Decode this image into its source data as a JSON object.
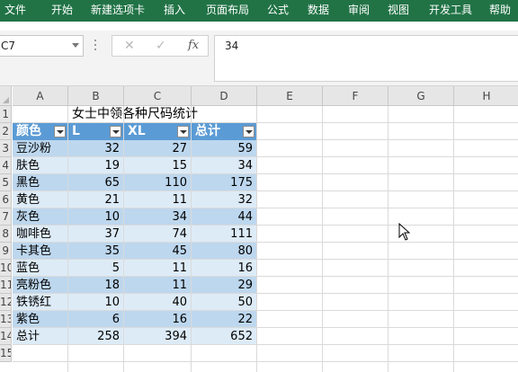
{
  "ribbon": {
    "tabs": [
      "文件",
      "开始",
      "新建选项卡",
      "插入",
      "页面布局",
      "公式",
      "数据",
      "审阅",
      "视图",
      "开发工具",
      "帮助"
    ]
  },
  "formula_bar": {
    "name_box": "C7",
    "cancel_symbol": "✕",
    "enter_symbol": "✓",
    "fx_label": "fx",
    "value": "34"
  },
  "grid": {
    "columns": [
      "A",
      "B",
      "C",
      "D",
      "E",
      "F",
      "G",
      "H"
    ],
    "row_numbers": [
      "1",
      "2",
      "3",
      "4",
      "5",
      "6",
      "7",
      "8",
      "9",
      "10",
      "11",
      "12",
      "13",
      "14",
      "15"
    ]
  },
  "table": {
    "title": "女士中领各种尺码统计",
    "headers": [
      "颜色",
      "L",
      "XL",
      "总计"
    ],
    "rows": [
      [
        "豆沙粉",
        "32",
        "27",
        "59"
      ],
      [
        "肤色",
        "19",
        "15",
        "34"
      ],
      [
        "黑色",
        "65",
        "110",
        "175"
      ],
      [
        "黄色",
        "21",
        "11",
        "32"
      ],
      [
        "灰色",
        "10",
        "34",
        "44"
      ],
      [
        "咖啡色",
        "37",
        "74",
        "111"
      ],
      [
        "卡其色",
        "35",
        "45",
        "80"
      ],
      [
        "蓝色",
        "5",
        "11",
        "16"
      ],
      [
        "亮粉色",
        "18",
        "11",
        "29"
      ],
      [
        "铁锈红",
        "10",
        "40",
        "50"
      ],
      [
        "紫色",
        "6",
        "16",
        "22"
      ]
    ],
    "total_row": [
      "总计",
      "258",
      "394",
      "652"
    ]
  },
  "colors": {
    "ribbon": "#217346",
    "header_fill": "#5b9bd5",
    "band_dark": "#bdd7ee",
    "band_light": "#ddebf7"
  }
}
